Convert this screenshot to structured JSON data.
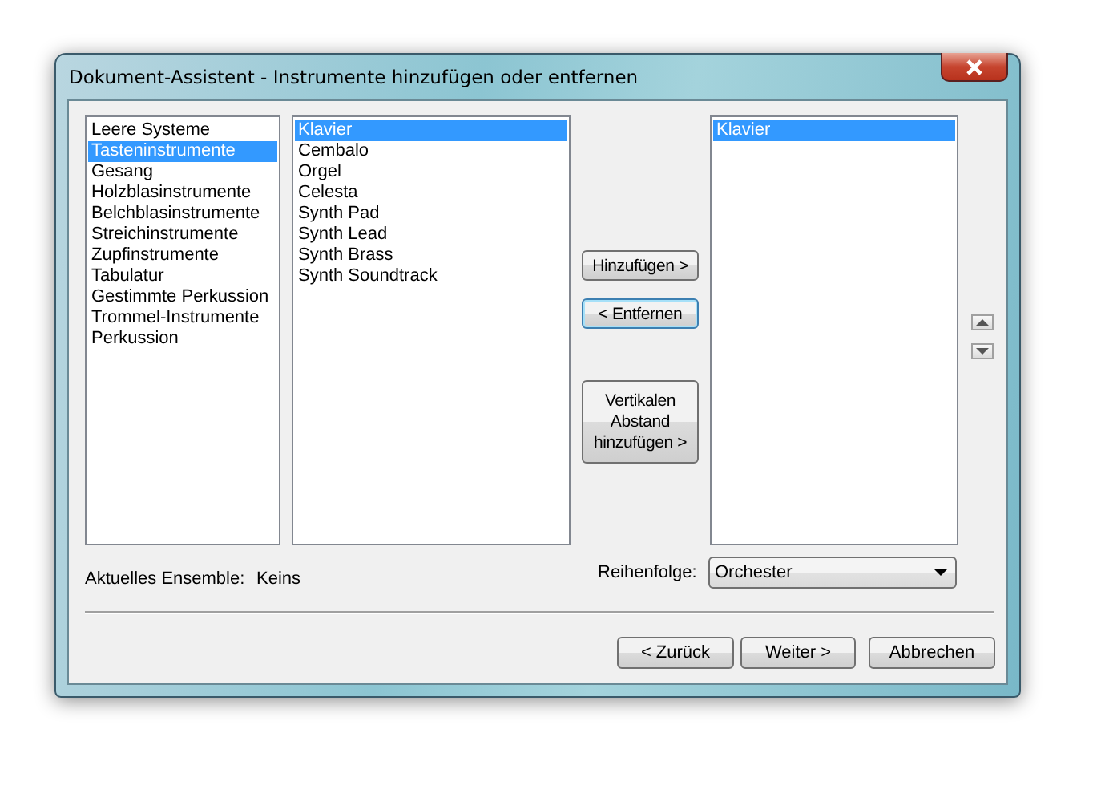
{
  "window": {
    "title": "Dokument-Assistent - Instrumente hinzufügen oder entfernen"
  },
  "categories": [
    {
      "label": "Leere Systeme",
      "selected": false
    },
    {
      "label": "Tasteninstrumente",
      "selected": true
    },
    {
      "label": "Gesang",
      "selected": false
    },
    {
      "label": "Holzblasinstrumente",
      "selected": false
    },
    {
      "label": "Belchblasinstrumente",
      "selected": false
    },
    {
      "label": "Streichinstrumente",
      "selected": false
    },
    {
      "label": "Zupfinstrumente",
      "selected": false
    },
    {
      "label": "Tabulatur",
      "selected": false
    },
    {
      "label": "Gestimmte Perkussion",
      "selected": false
    },
    {
      "label": "Trommel-Instrumente",
      "selected": false
    },
    {
      "label": "Perkussion",
      "selected": false
    }
  ],
  "instruments": [
    {
      "label": "Klavier",
      "selected": true
    },
    {
      "label": "Cembalo",
      "selected": false
    },
    {
      "label": "Orgel",
      "selected": false
    },
    {
      "label": "Celesta",
      "selected": false
    },
    {
      "label": "Synth Pad",
      "selected": false
    },
    {
      "label": "Synth Lead",
      "selected": false
    },
    {
      "label": "Synth Brass",
      "selected": false
    },
    {
      "label": "Synth Soundtrack",
      "selected": false
    }
  ],
  "actions": [
    {
      "label": "Hinzufügen >",
      "focused": false
    },
    {
      "label": "< Entfernen",
      "focused": true
    },
    {
      "label": "Vertikalen Abstand hinzufügen >",
      "focused": false
    }
  ],
  "ensemble_list": [
    {
      "label": "Klavier",
      "selected": true
    }
  ],
  "current_ensemble": {
    "label": "Aktuelles Ensemble:",
    "value": "Keins"
  },
  "order": {
    "label": "Reihenfolge:",
    "value": "Orchester"
  },
  "buttons": [
    {
      "label": "< Zurück"
    },
    {
      "label": "Weiter >"
    },
    {
      "label": "Abbrechen"
    }
  ]
}
